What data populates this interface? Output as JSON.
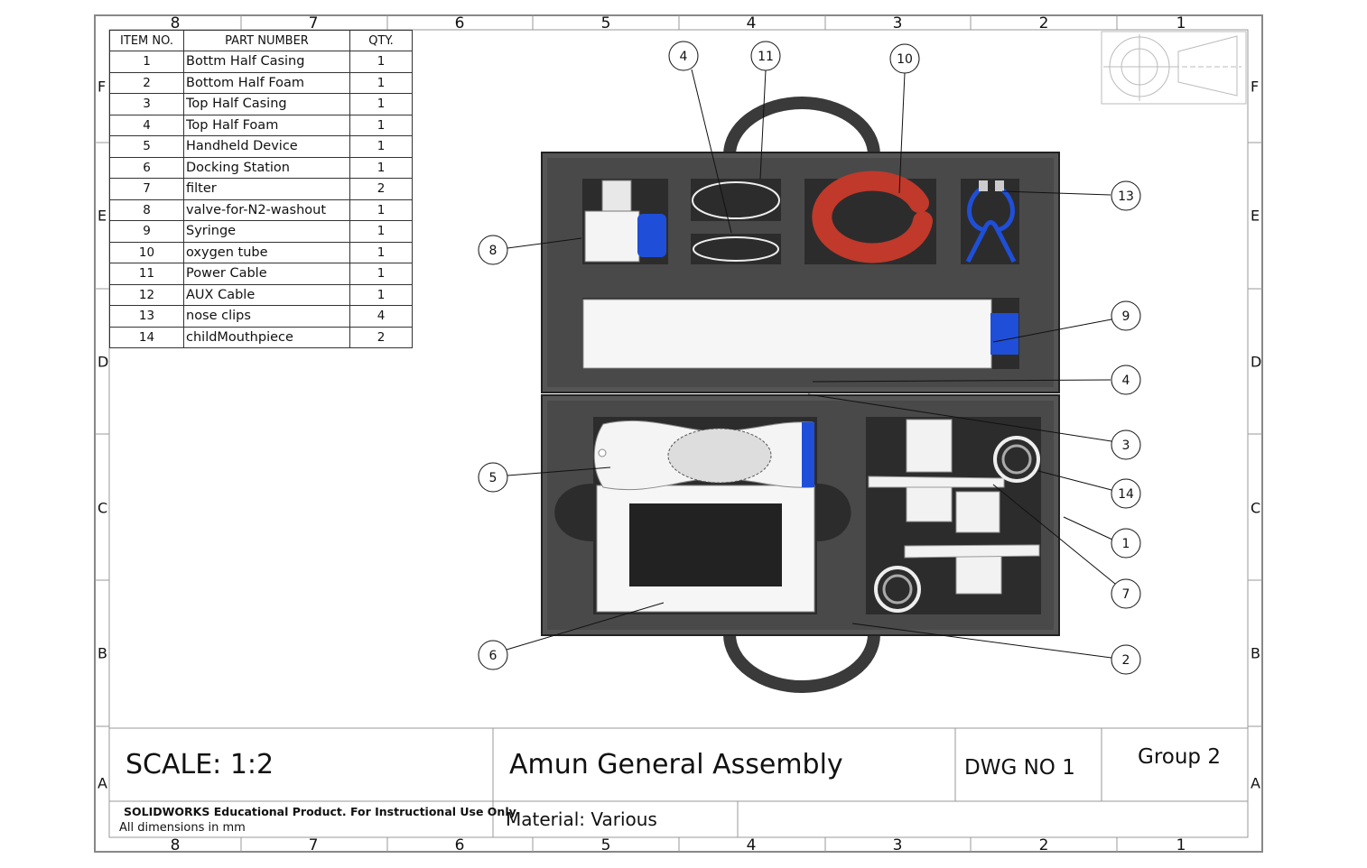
{
  "zones": {
    "columns": [
      "8",
      "7",
      "6",
      "5",
      "4",
      "3",
      "2",
      "1"
    ],
    "rows": [
      "F",
      "E",
      "D",
      "C",
      "B",
      "A"
    ]
  },
  "bom": {
    "headers": {
      "item": "ITEM NO.",
      "part": "PART NUMBER",
      "qty": "QTY."
    },
    "rows": [
      {
        "item": "1",
        "part": "Bottm Half Casing",
        "qty": "1"
      },
      {
        "item": "2",
        "part": "Bottom Half Foam",
        "qty": "1"
      },
      {
        "item": "3",
        "part": "Top Half Casing",
        "qty": "1"
      },
      {
        "item": "4",
        "part": "Top Half Foam",
        "qty": "1"
      },
      {
        "item": "5",
        "part": "Handheld Device",
        "qty": "1"
      },
      {
        "item": "6",
        "part": "Docking Station",
        "qty": "1"
      },
      {
        "item": "7",
        "part": "filter",
        "qty": "2"
      },
      {
        "item": "8",
        "part": "valve-for-N2-washout",
        "qty": "1"
      },
      {
        "item": "9",
        "part": "Syringe",
        "qty": "1"
      },
      {
        "item": "10",
        "part": "oxygen tube",
        "qty": "1"
      },
      {
        "item": "11",
        "part": "Power Cable",
        "qty": "1"
      },
      {
        "item": "12",
        "part": "AUX Cable",
        "qty": "1"
      },
      {
        "item": "13",
        "part": "nose clips",
        "qty": "4"
      },
      {
        "item": "14",
        "part": "childMouthpiece",
        "qty": "2"
      }
    ]
  },
  "balloons": [
    "4",
    "11",
    "10",
    "13",
    "8",
    "9",
    "4",
    "3",
    "5",
    "14",
    "1",
    "7",
    "6",
    "2"
  ],
  "title_block": {
    "scale": "SCALE:  1:2",
    "title": "Amun General Assembly",
    "dwg_no": "DWG NO 1",
    "group": "Group 2",
    "edu_notice": "SOLIDWORKS Educational Product. For Instructional Use Only",
    "dimensions_note": "All dimensions in mm",
    "material": "Material: Various"
  },
  "colors": {
    "case": "#505050",
    "foam": "#3c3c3c",
    "cutout": "#2a2a2a",
    "accent_blue": "#1f4fd8",
    "tube_red": "#c0392b"
  }
}
